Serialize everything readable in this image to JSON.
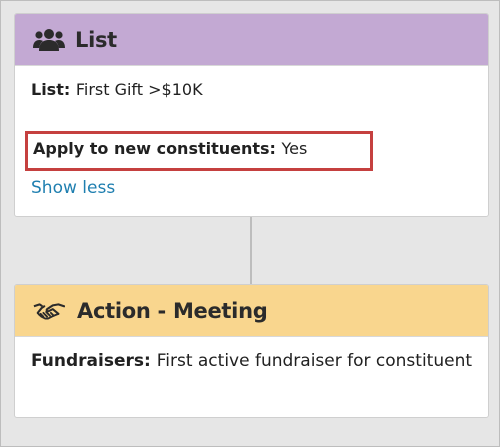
{
  "list_card": {
    "icon": "people-group-icon",
    "title": "List",
    "list_label": "List:",
    "list_value": "First Gift >$10K",
    "apply_label": "Apply to new constituents:",
    "apply_value": "Yes",
    "show_less": "Show less"
  },
  "action_card": {
    "icon": "handshake-icon",
    "title": "Action - Meeting",
    "fundraisers_label": "Fundraisers:",
    "fundraisers_value": "First active fundraiser for constituent"
  },
  "colors": {
    "list_header": "#c3a9d3",
    "action_header": "#f9d68e",
    "highlight_border": "#c5403f",
    "link": "#1f7fb0"
  }
}
